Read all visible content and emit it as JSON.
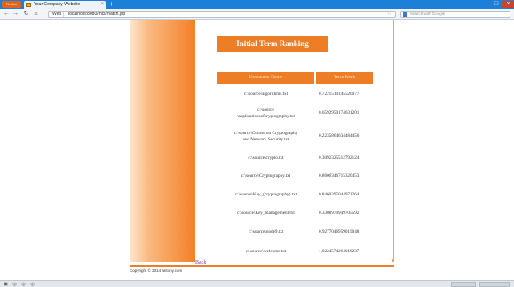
{
  "browser": {
    "menu_button": "Firefox",
    "tab_title": "Your Company Website",
    "tab_close": "×",
    "new_tab": "+",
    "back_icon": "←",
    "forward_icon": "→",
    "reload_icon": "↻",
    "home_icon": "⌂",
    "url_site": "Web",
    "url": "localhost:8080/mcl/match.jsp",
    "bookmark_icon": "☆",
    "search_placeholder": "Search with Google"
  },
  "page": {
    "title": "Initial Term Ranking",
    "table": {
      "headers": [
        "Document Name",
        "Term Rank"
      ],
      "rows": [
        {
          "doc": "c:\\source\\algorithms.txt",
          "rank": "0.7221510145520077"
        },
        {
          "doc": "c:\\source\n\\applicationsofcryptography.txt",
          "rank": "0.6592959174631201"
        },
        {
          "doc": "c:\\source\\Course on Cryptography\nand Network Security.txt",
          "rank": "0.2235864634484456"
        },
        {
          "doc": "c:\\source\\crypto.txt",
          "rank": "0.3092325512792124"
        },
        {
          "doc": "c:\\source\\Cryptography.txt",
          "rank": "0.8606346715320453"
        },
        {
          "doc": "c:\\source\\Key_(cryptography).txt",
          "rank": "0.8460395044971264"
        },
        {
          "doc": "c:\\source\\Key_management.txt",
          "rank": "0.3308979949705592"
        },
        {
          "doc": "c:\\source\\node9.txt",
          "rank": "0.9277046959019048"
        },
        {
          "doc": "c:\\source\\welcome.txt",
          "rank": "1.0224574264019237"
        }
      ]
    },
    "back_link": "Back",
    "footer": "Copyright © 2014 antony.com"
  },
  "colors": {
    "accent": "#ee7e25",
    "titlebar": "#1c7fd8"
  }
}
